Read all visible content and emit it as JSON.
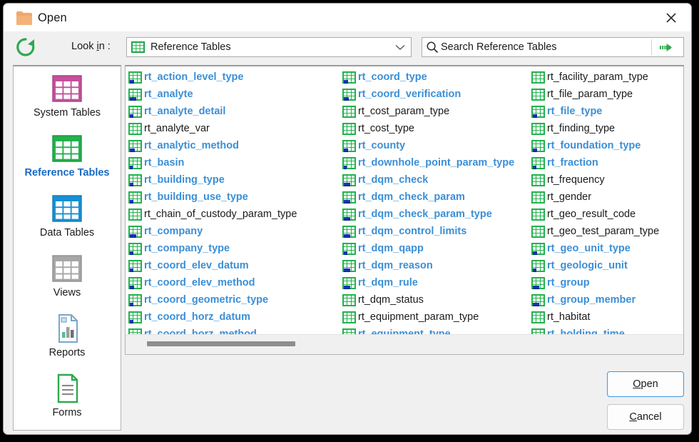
{
  "window": {
    "title": "Open",
    "folder_icon": "folder-icon",
    "close_icon": "close-icon"
  },
  "toolbar": {
    "refresh_icon": "refresh-icon",
    "lookin_label_pre": "Look ",
    "lookin_label_mnemonic": "i",
    "lookin_label_post": "n :",
    "path_value": "Reference Tables",
    "path_icon": "table-icon",
    "dropdown_icon": "chevron-down-icon",
    "search_placeholder": "Search Reference Tables",
    "search_value": "",
    "search_icon": "search-icon",
    "search_go_icon": "green-arrow-right-icon"
  },
  "sidebar": {
    "items": [
      {
        "label": "System Tables",
        "icon": "table-icon-magenta",
        "color": "#c4509b",
        "selected": false
      },
      {
        "label": "Reference Tables",
        "icon": "table-icon-green",
        "color": "#22b14c",
        "selected": true
      },
      {
        "label": "Data Tables",
        "icon": "table-icon-blue",
        "color": "#1790d4",
        "selected": false
      },
      {
        "label": "Views",
        "icon": "table-icon-gray",
        "color": "#a6a6a6",
        "selected": false
      },
      {
        "label": "Reports",
        "icon": "report-document-icon",
        "color": "#7aa6c8",
        "selected": false
      },
      {
        "label": "Forms",
        "icon": "form-document-icon",
        "color": "#2fa84f",
        "selected": false
      }
    ]
  },
  "file_list": {
    "columns": [
      [
        {
          "name": "rt_action_level_type",
          "visited": true,
          "badge": 6
        },
        {
          "name": "rt_analyte",
          "visited": true,
          "badge": 9
        },
        {
          "name": "rt_analyte_detail",
          "visited": true,
          "badge": 5
        },
        {
          "name": "rt_analyte_var",
          "visited": false,
          "badge": 0
        },
        {
          "name": "rt_analytic_method",
          "visited": true,
          "badge": 7
        },
        {
          "name": "rt_basin",
          "visited": true,
          "badge": 4
        },
        {
          "name": "rt_building_type",
          "visited": true,
          "badge": 5
        },
        {
          "name": "rt_building_use_type",
          "visited": true,
          "badge": 5
        },
        {
          "name": "rt_chain_of_custody_param_type",
          "visited": false,
          "badge": 0
        },
        {
          "name": "rt_company",
          "visited": true,
          "badge": 9
        },
        {
          "name": "rt_company_type",
          "visited": true,
          "badge": 5
        },
        {
          "name": "rt_coord_elev_datum",
          "visited": true,
          "badge": 5
        },
        {
          "name": "rt_coord_elev_method",
          "visited": true,
          "badge": 6
        },
        {
          "name": "rt_coord_geometric_type",
          "visited": true,
          "badge": 5
        },
        {
          "name": "rt_coord_horz_datum",
          "visited": true,
          "badge": 5
        },
        {
          "name": "rt_coord_horz_method",
          "visited": true,
          "badge": 6
        }
      ],
      [
        {
          "name": "rt_coord_type",
          "visited": true,
          "badge": 6
        },
        {
          "name": "rt_coord_verification",
          "visited": true,
          "badge": 7
        },
        {
          "name": "rt_cost_param_type",
          "visited": false,
          "badge": 0
        },
        {
          "name": "rt_cost_type",
          "visited": false,
          "badge": 0
        },
        {
          "name": "rt_county",
          "visited": true,
          "badge": 6
        },
        {
          "name": "rt_downhole_point_param_type",
          "visited": true,
          "badge": 4
        },
        {
          "name": "rt_dqm_check",
          "visited": true,
          "badge": 9
        },
        {
          "name": "rt_dqm_check_param",
          "visited": true,
          "badge": 9
        },
        {
          "name": "rt_dqm_check_param_type",
          "visited": true,
          "badge": 9
        },
        {
          "name": "rt_dqm_control_limits",
          "visited": true,
          "badge": 9
        },
        {
          "name": "rt_dqm_qapp",
          "visited": true,
          "badge": 5
        },
        {
          "name": "rt_dqm_reason",
          "visited": true,
          "badge": 9
        },
        {
          "name": "rt_dqm_rule",
          "visited": true,
          "badge": 9
        },
        {
          "name": "rt_dqm_status",
          "visited": false,
          "badge": 0
        },
        {
          "name": "rt_equipment_param_type",
          "visited": false,
          "badge": 0
        },
        {
          "name": "rt_equipment_type",
          "visited": true,
          "badge": 5
        }
      ],
      [
        {
          "name": "rt_facility_param_type",
          "visited": false,
          "badge": 0
        },
        {
          "name": "rt_file_param_type",
          "visited": false,
          "badge": 0
        },
        {
          "name": "rt_file_type",
          "visited": true,
          "badge": 6
        },
        {
          "name": "rt_finding_type",
          "visited": false,
          "badge": 0
        },
        {
          "name": "rt_foundation_type",
          "visited": true,
          "badge": 6
        },
        {
          "name": "rt_fraction",
          "visited": true,
          "badge": 5
        },
        {
          "name": "rt_frequency",
          "visited": false,
          "badge": 0
        },
        {
          "name": "rt_gender",
          "visited": false,
          "badge": 0
        },
        {
          "name": "rt_geo_result_code",
          "visited": false,
          "badge": 0
        },
        {
          "name": "rt_geo_test_param_type",
          "visited": false,
          "badge": 0
        },
        {
          "name": "rt_geo_unit_type",
          "visited": true,
          "badge": 6
        },
        {
          "name": "rt_geologic_unit",
          "visited": true,
          "badge": 5
        },
        {
          "name": "rt_group",
          "visited": true,
          "badge": 9
        },
        {
          "name": "rt_group_member",
          "visited": true,
          "badge": 9
        },
        {
          "name": "rt_habitat",
          "visited": false,
          "badge": 0
        },
        {
          "name": "rt_holding_time",
          "visited": true,
          "badge": 6
        }
      ]
    ]
  },
  "buttons": {
    "open_pre": "",
    "open_mnemonic": "O",
    "open_post": "pen",
    "cancel_mnemonic": "C",
    "cancel_post": "ancel"
  },
  "colors": {
    "accent_blue": "#3b8fd6",
    "selected_blue": "#1769c4",
    "table_green": "#22b14c",
    "badge_blue": "#1433b0",
    "focus_border": "#3f96e0"
  }
}
